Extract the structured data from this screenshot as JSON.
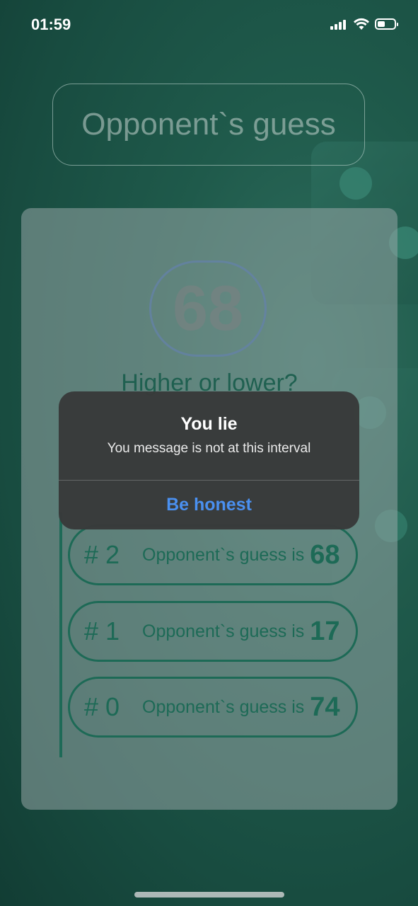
{
  "status_bar": {
    "time": "01:59"
  },
  "header": {
    "title": "Opponent`s guess"
  },
  "game": {
    "current_guess": "68",
    "prompt": "Higher or lower?"
  },
  "history": [
    {
      "index": "# 2",
      "text": "Opponent`s guess is",
      "value": "68"
    },
    {
      "index": "# 1",
      "text": "Opponent`s guess is",
      "value": "17"
    },
    {
      "index": "# 0",
      "text": "Opponent`s guess is",
      "value": "74"
    }
  ],
  "alert": {
    "title": "You lie",
    "message": "You message is not at this interval",
    "button_label": "Be honest"
  },
  "colors": {
    "background": "#1f5a4b",
    "accent_green": "#1d6a56",
    "alert_button_blue": "#4a90f0"
  }
}
